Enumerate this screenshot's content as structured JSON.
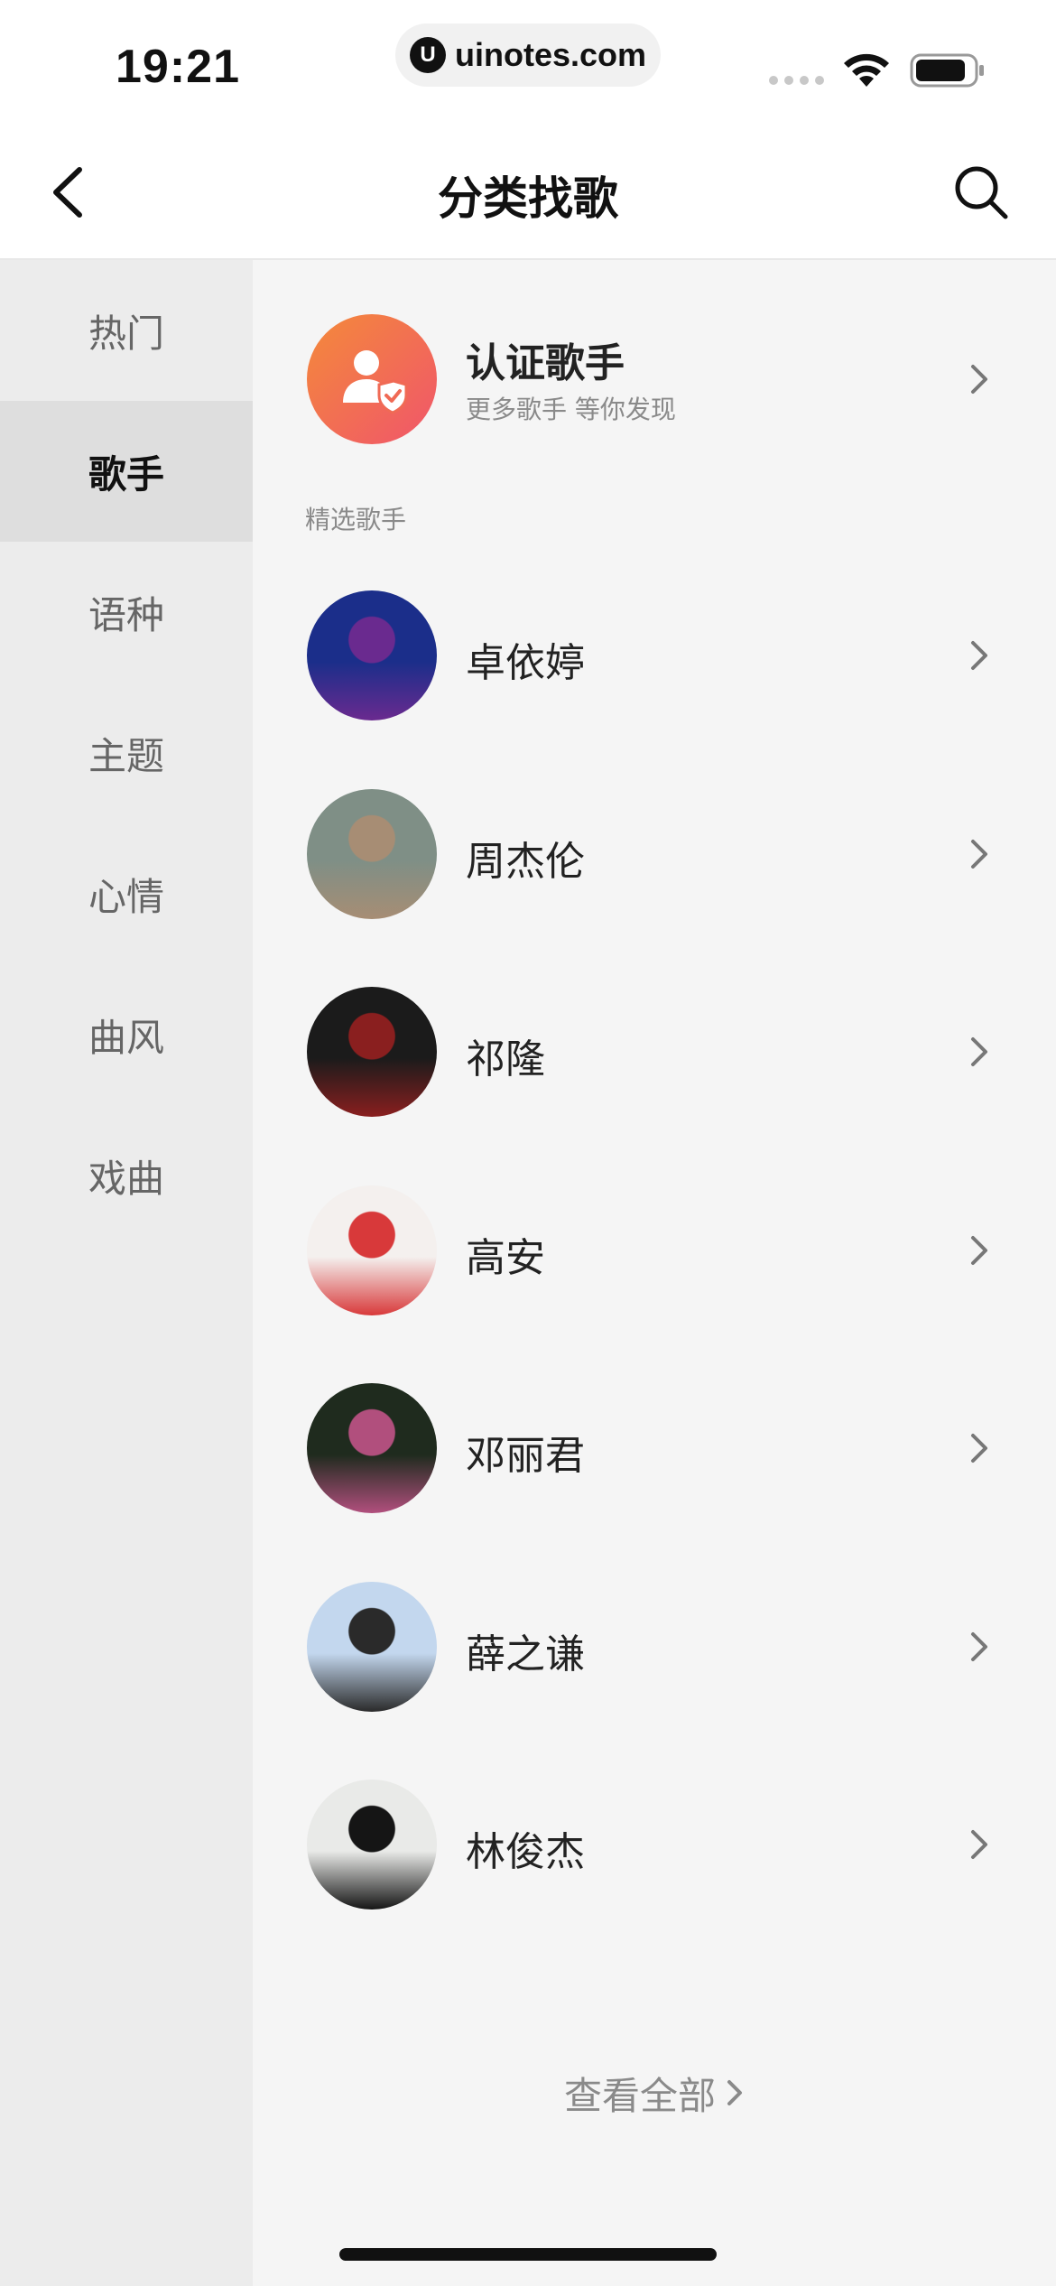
{
  "status_bar": {
    "time": "19:21",
    "url": "uinotes.com",
    "url_logo": "U"
  },
  "nav": {
    "title": "分类找歌",
    "back_icon": "chevron-left-icon",
    "search_icon": "search-icon"
  },
  "sidebar": {
    "items": [
      {
        "label": "热门",
        "active": false
      },
      {
        "label": "歌手",
        "active": true
      },
      {
        "label": "语种",
        "active": false
      },
      {
        "label": "主题",
        "active": false
      },
      {
        "label": "心情",
        "active": false
      },
      {
        "label": "曲风",
        "active": false
      },
      {
        "label": "戏曲",
        "active": false
      }
    ]
  },
  "main": {
    "certified": {
      "title": "认证歌手",
      "subtitle": "更多歌手 等你发现"
    },
    "section_label": "精选歌手",
    "artists": [
      {
        "name": "卓依婷",
        "colors": [
          "#1b2e8a",
          "#6a2a8f"
        ]
      },
      {
        "name": "周杰伦",
        "colors": [
          "#7f8f86",
          "#a78d74"
        ]
      },
      {
        "name": "祁隆",
        "colors": [
          "#1b1b1b",
          "#8a1f1f"
        ]
      },
      {
        "name": "高安",
        "colors": [
          "#f4f0ee",
          "#d8393a"
        ]
      },
      {
        "name": "邓丽君",
        "colors": [
          "#1f2b1e",
          "#b14f7d"
        ]
      },
      {
        "name": "薛之谦",
        "colors": [
          "#c3d7ee",
          "#2a2a2a"
        ]
      },
      {
        "name": "林俊杰",
        "colors": [
          "#e9eae8",
          "#151515"
        ]
      }
    ],
    "see_all": "查看全部"
  },
  "colors": {
    "sidebar_bg": "#ececec",
    "sidebar_active_bg": "#dedede",
    "main_bg": "#f5f5f5",
    "cert_gradient_start": "#f48a3a",
    "cert_gradient_end": "#f0556b"
  }
}
